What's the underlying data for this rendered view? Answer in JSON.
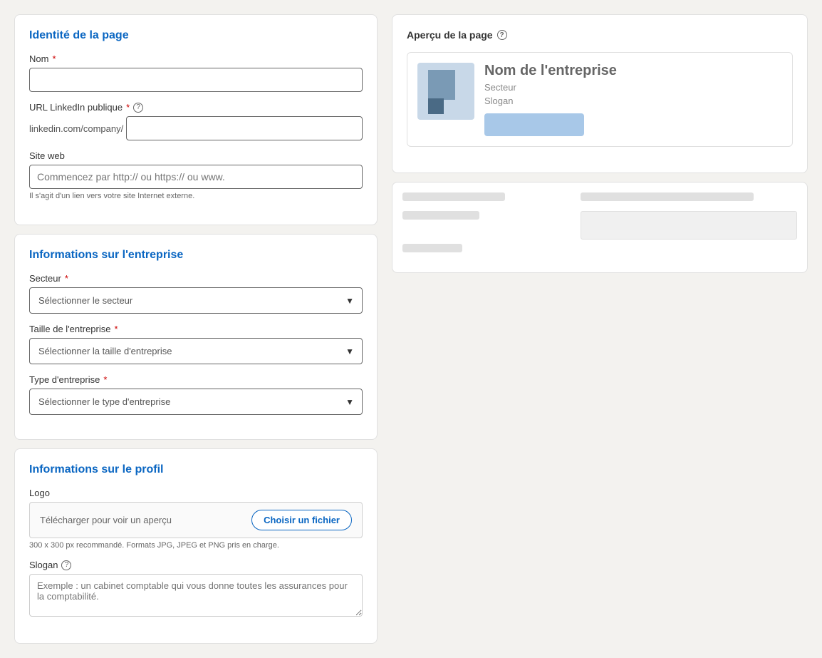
{
  "sections": {
    "identity": {
      "title": "Identité de la page",
      "name_label": "Nom",
      "name_required": "*",
      "url_label": "URL LinkedIn publique",
      "url_required": "*",
      "url_prefix": "linkedin.com/company/",
      "url_placeholder": "",
      "website_label": "Site web",
      "website_placeholder": "Commencez par http:// ou https:// ou www.",
      "website_hint": "Il s'agit d'un lien vers votre site Internet externe."
    },
    "company_info": {
      "title": "Informations sur l'entreprise",
      "sector_label": "Secteur",
      "sector_required": "*",
      "sector_placeholder": "Sélectionner le secteur",
      "size_label": "Taille de l'entreprise",
      "size_required": "*",
      "size_placeholder": "Sélectionner la taille d'entreprise",
      "type_label": "Type d'entreprise",
      "type_required": "*",
      "type_placeholder": "Sélectionner le type d'entreprise"
    },
    "profile_info": {
      "title": "Informations sur le profil",
      "logo_label": "Logo",
      "upload_text": "Télécharger pour voir un aperçu",
      "choose_file_btn": "Choisir un fichier",
      "logo_hint": "300 x 300 px recommandé. Formats JPG, JPEG et PNG pris en charge.",
      "slogan_label": "Slogan",
      "slogan_placeholder": "Exemple : un cabinet comptable qui vous donne toutes les assurances pour la comptabilité."
    }
  },
  "preview": {
    "title": "Aperçu de la page",
    "company_name": "Nom de l'entreprise",
    "sector": "Secteur",
    "slogan": "Slogan"
  },
  "icons": {
    "help": "?",
    "chevron_down": "▼"
  }
}
